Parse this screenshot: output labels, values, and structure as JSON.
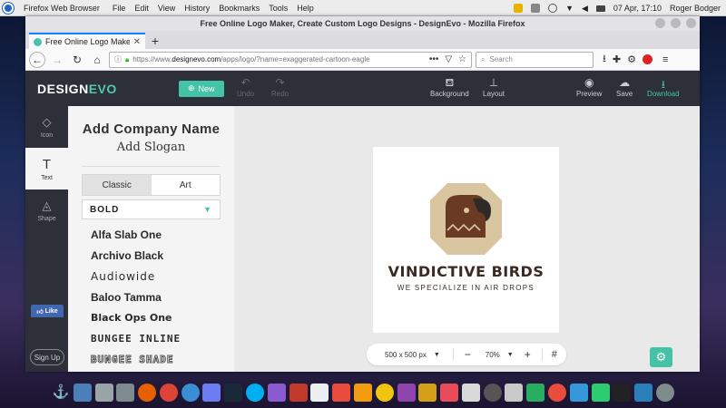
{
  "os": {
    "app_name": "Firefox Web Browser",
    "menu": [
      "File",
      "Edit",
      "View",
      "History",
      "Bookmarks",
      "Tools",
      "Help"
    ],
    "clock": "07 Apr, 17:10",
    "user": "Roger Bodger"
  },
  "browser": {
    "window_title": "Free Online Logo Maker, Create Custom Logo Designs - DesignEvo - Mozilla Firefox",
    "tab_title": "Free Online Logo Maker, Cre",
    "url_prefix": "https://www.",
    "url_domain": "designevo.com",
    "url_path": "/apps/logo/?name=exaggerated-cartoon-eagle",
    "search_placeholder": "Search"
  },
  "designevo": {
    "logo_main": "DESIGN",
    "logo_accent": "EVO",
    "new_label": "New",
    "undo_label": "Undo",
    "redo_label": "Redo",
    "background_label": "Background",
    "layout_label": "Layout",
    "preview_label": "Preview",
    "save_label": "Save",
    "download_label": "Download",
    "accent_color": "#45c3a6",
    "sidebar": [
      {
        "label": "Icon",
        "icon": "diamond-icon"
      },
      {
        "label": "Text",
        "icon": "text-icon"
      },
      {
        "label": "Shape",
        "icon": "shapes-icon"
      }
    ],
    "fb_like": "Like",
    "sign_up": "Sign Up",
    "panel": {
      "add_company": "Add Company Name",
      "add_slogan": "Add Slogan",
      "tab_classic": "Classic",
      "tab_art": "Art",
      "font_filter": "BOLD",
      "fonts": [
        "Alfa Slab One",
        "Archivo Black",
        "Audiowide",
        "Baloo Tamma",
        "Black Ops One",
        "BUNGEE INLINE",
        "BUNGEE SHADE"
      ]
    },
    "canvas": {
      "company_name": "VINDICTIVE BIRDS",
      "slogan": "WE SPECIALIZE IN AIR DROPS",
      "size": "500 x 500 px",
      "zoom": "70%",
      "badge_color": "#d9c6a0",
      "bird_color": "#6b3a23",
      "beak_color": "#2e2a27"
    }
  }
}
